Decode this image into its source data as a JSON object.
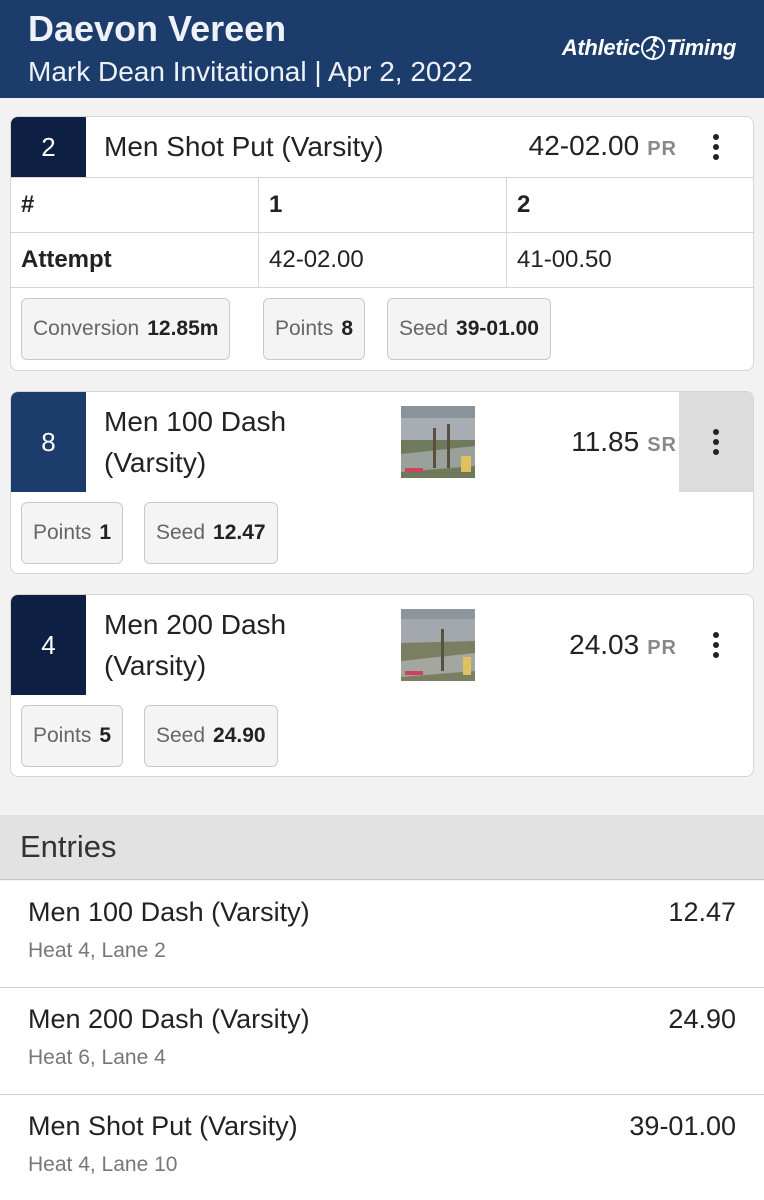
{
  "header": {
    "athlete_name": "Daevon Vereen",
    "meet_line": "Mark Dean Invitational | Apr 2, 2022",
    "brand_left": "Athletic",
    "brand_right": "Timing"
  },
  "results": [
    {
      "place": "2",
      "event": "Men Shot Put (Varsity)",
      "mark": "42-02.00",
      "mark_tag": "PR",
      "attempts": {
        "header": [
          "#",
          "1",
          "2"
        ],
        "row": [
          "Attempt",
          "42-02.00",
          "41-00.50"
        ]
      },
      "chips": [
        {
          "label": "Conversion",
          "value": "12.85m"
        },
        {
          "label": "Points",
          "value": "8"
        },
        {
          "label": "Seed",
          "value": "39-01.00"
        }
      ]
    },
    {
      "place": "8",
      "event_line1": "Men 100 Dash",
      "event_line2": "(Varsity)",
      "mark": "11.85",
      "mark_tag": "SR",
      "chips": [
        {
          "label": "Points",
          "value": "1"
        },
        {
          "label": "Seed",
          "value": "12.47"
        }
      ]
    },
    {
      "place": "4",
      "event_line1": "Men 200 Dash",
      "event_line2": "(Varsity)",
      "mark": "24.03",
      "mark_tag": "PR",
      "chips": [
        {
          "label": "Points",
          "value": "5"
        },
        {
          "label": "Seed",
          "value": "24.90"
        }
      ]
    }
  ],
  "entries": {
    "title": "Entries",
    "items": [
      {
        "event": "Men 100 Dash (Varsity)",
        "detail": "Heat 4, Lane 2",
        "seed": "12.47"
      },
      {
        "event": "Men 200 Dash (Varsity)",
        "detail": "Heat 6, Lane 4",
        "seed": "24.90"
      },
      {
        "event": "Men Shot Put (Varsity)",
        "detail": "Heat 4, Lane 10",
        "seed": "39-01.00"
      }
    ]
  },
  "colors": {
    "header_bg": "#1c3d6b",
    "place_dark": "#0d1f42",
    "place_mid": "#1c3d6b"
  }
}
